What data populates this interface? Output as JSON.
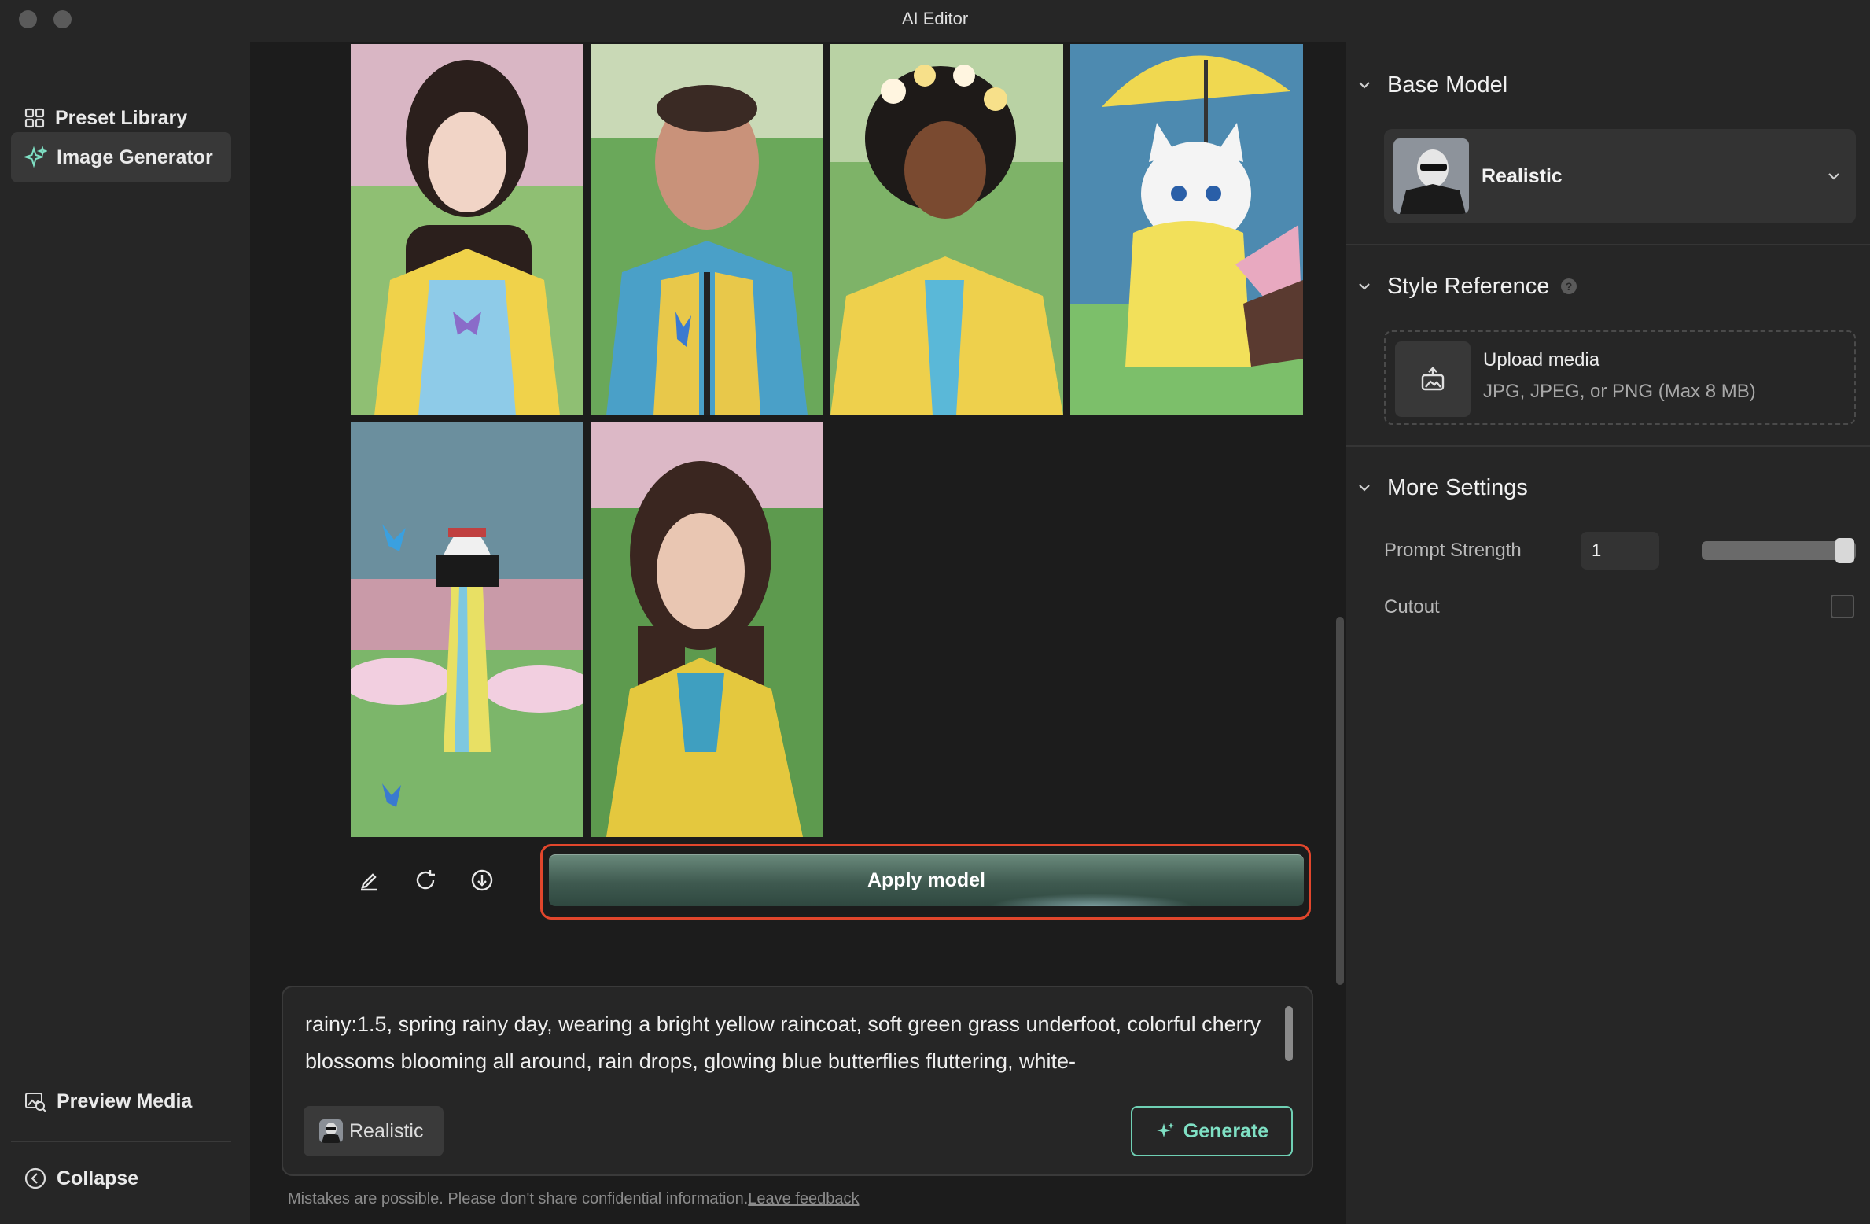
{
  "window": {
    "title": "AI Editor"
  },
  "sidebar": {
    "items": [
      {
        "label": "Preset Library",
        "icon": "grid-icon"
      },
      {
        "label": "Image Generator",
        "icon": "sparkle-icon",
        "active": true
      }
    ],
    "bottom_items": [
      {
        "label": "Preview Media",
        "icon": "preview-media-icon"
      },
      {
        "label": "Collapse",
        "icon": "collapse-circle-icon"
      }
    ]
  },
  "gallery": {
    "images": [
      {
        "subject": "woman in yellow and blue jacket with butterfly"
      },
      {
        "subject": "man in yellow and blue hooded jacket with butterflies"
      },
      {
        "subject": "smiling woman with flower crown in yellow raincoat"
      },
      {
        "subject": "cartoon white cat in yellow raincoat under umbrella"
      },
      {
        "subject": "yellow and white lighthouse among blossoms and butterflies"
      },
      {
        "subject": "woman in yellow raincoat on green grass"
      }
    ],
    "tools": [
      "edit-pencil-icon",
      "regenerate-icon",
      "download-icon"
    ],
    "apply_label": "Apply model"
  },
  "prompt": {
    "text": "rainy:1.5, spring rainy day, wearing a bright yellow raincoat, soft green grass underfoot, colorful cherry blossoms blooming all around, rain drops, glowing blue butterflies fluttering, white-",
    "model_chip": "Realistic",
    "generate_label": "Generate"
  },
  "footer": {
    "note": "Mistakes are possible. Please don't share confidential information.",
    "feedback_link": "Leave feedback"
  },
  "right_panel": {
    "base_model": {
      "title": "Base Model",
      "selected": "Realistic"
    },
    "style_reference": {
      "title": "Style Reference",
      "upload_title": "Upload media",
      "upload_hint": "JPG, JPEG, or PNG (Max 8 MB)"
    },
    "more_settings": {
      "title": "More Settings",
      "prompt_strength_label": "Prompt Strength",
      "prompt_strength_value": "1",
      "prompt_strength_fraction": 1.0,
      "cutout_label": "Cutout",
      "cutout_checked": false
    }
  },
  "colors": {
    "accent_green": "#6fd0b4",
    "highlight_red": "#e2462c",
    "apply_button": "#3f5a50"
  }
}
